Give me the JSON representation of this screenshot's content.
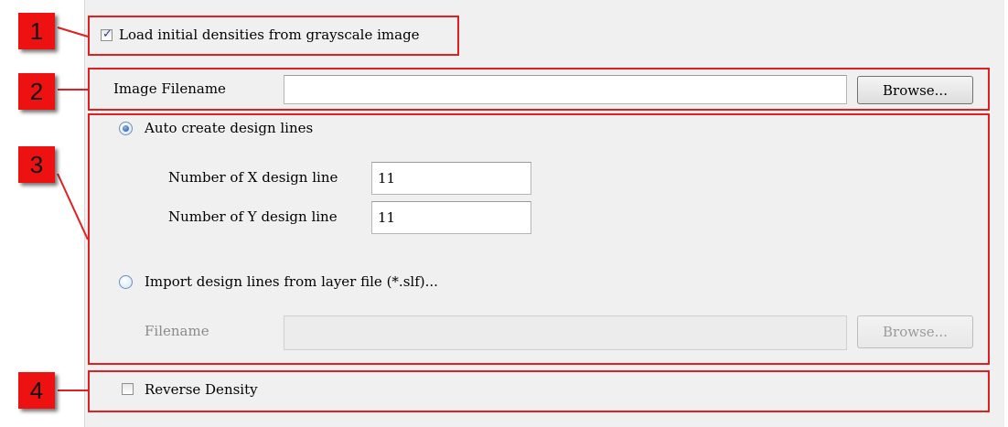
{
  "callouts": [
    "1",
    "2",
    "3",
    "4"
  ],
  "load_densities": {
    "label": "Load initial densities from grayscale image",
    "checked": true
  },
  "image_file": {
    "label": "Image Filename",
    "value": "",
    "browse_label": "Browse..."
  },
  "design_lines": {
    "auto_option": {
      "label": "Auto create design lines",
      "selected": true
    },
    "x_label": "Number of X design line",
    "x_value": "11",
    "y_label": "Number of Y design line",
    "y_value": "11",
    "import_option": {
      "label": "Import design lines from layer file (*.slf)...",
      "selected": false
    },
    "filename_label": "Filename",
    "filename_value": "",
    "browse_label": "Browse..."
  },
  "reverse_density": {
    "label": "Reverse Density",
    "checked": false
  }
}
